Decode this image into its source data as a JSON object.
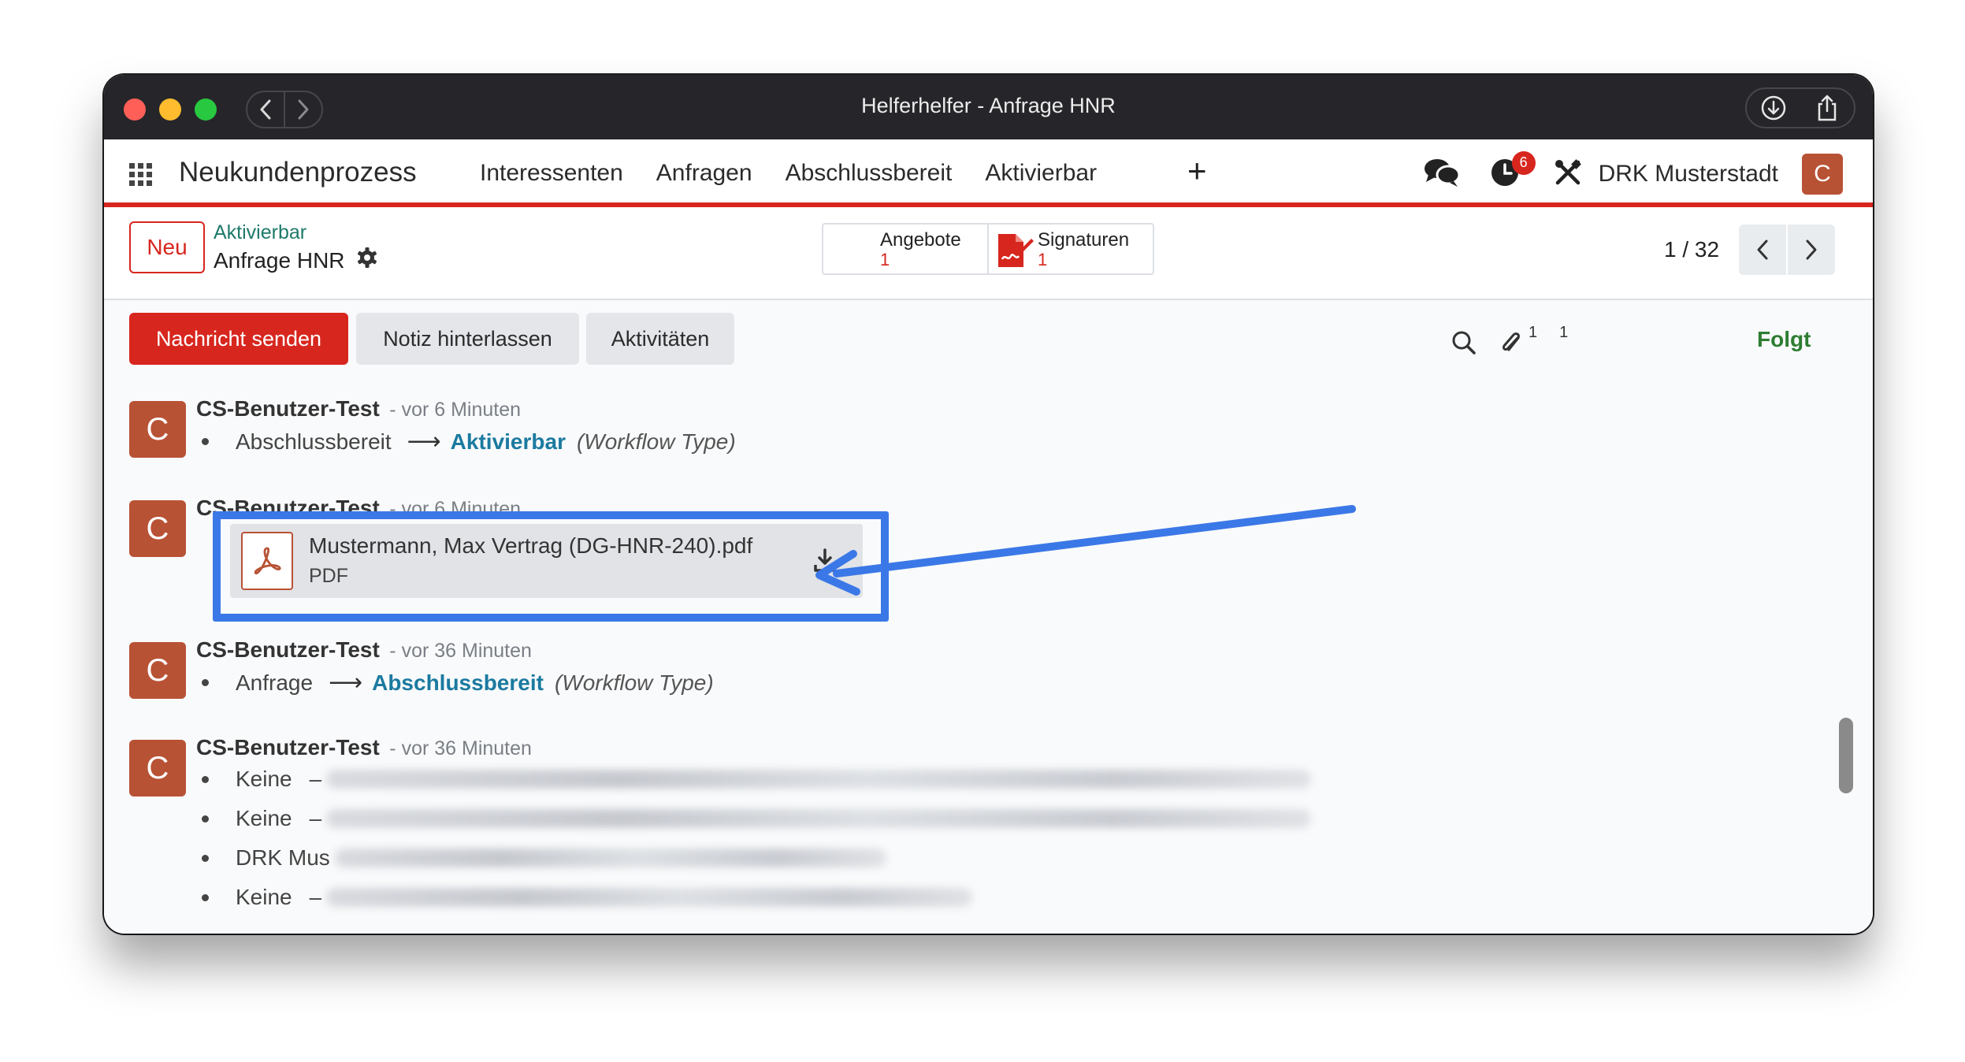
{
  "window": {
    "title": "Helferhelfer - Anfrage HNR"
  },
  "navbar": {
    "app_name": "Neukundenprozess",
    "menu": [
      "Interessenten",
      "Anfragen",
      "Abschlussbereit",
      "Aktivierbar"
    ],
    "plus": "+",
    "activity_count": "6",
    "company": "DRK Musterstadt",
    "avatar_letter": "C"
  },
  "control": {
    "new_button": "Neu",
    "breadcrumb_parent": "Aktivierbar",
    "breadcrumb_current": "Anfrage HNR",
    "smart_buttons": [
      {
        "label": "Angebote",
        "count": "1"
      },
      {
        "label": "Signaturen",
        "count": "1"
      }
    ],
    "pager": "1 / 32"
  },
  "chatter": {
    "send_message": "Nachricht senden",
    "log_note": "Notiz hinterlassen",
    "activities": "Aktivitäten",
    "attachment_count": "1",
    "follower_count": "1",
    "follow": "Folgt",
    "messages": [
      {
        "avatar": "C",
        "author": "CS-Benutzer-Test",
        "time": "- vor 6 Minuten",
        "change": {
          "old": "Abschlussbereit",
          "new": "Aktivierbar",
          "field": "(Workflow Type)"
        }
      },
      {
        "avatar": "C",
        "author": "CS-Benutzer-Test",
        "time": "- vor 6 Minuten",
        "attachment": {
          "name": "Mustermann, Max Vertrag (DG-HNR-240).pdf",
          "type": "PDF"
        }
      },
      {
        "avatar": "C",
        "author": "CS-Benutzer-Test",
        "time": "- vor 36 Minuten",
        "change": {
          "old": "Anfrage",
          "new": "Abschlussbereit",
          "field": "(Workflow Type)"
        }
      },
      {
        "avatar": "C",
        "author": "CS-Benutzer-Test",
        "time": "- vor 36 Minuten",
        "items": [
          "Keine",
          "Keine",
          "DRK Mus",
          "Keine"
        ]
      }
    ]
  },
  "colors": {
    "brand_red": "#d7261e",
    "avatar": "#b85235",
    "link": "#1b7aa0",
    "highlight": "#3b78e7",
    "follow": "#2e7d32"
  }
}
